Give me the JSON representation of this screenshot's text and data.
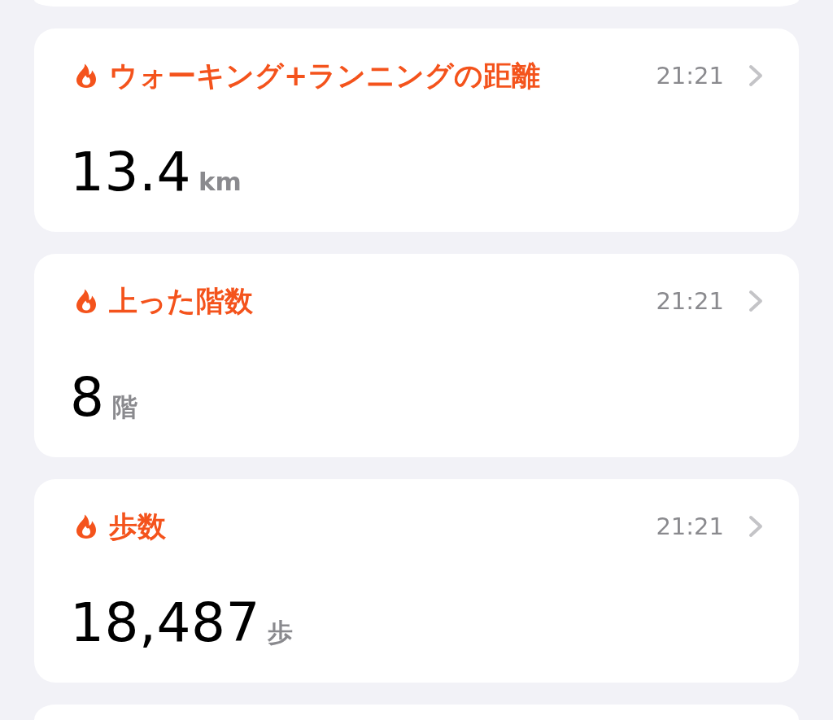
{
  "metrics": [
    {
      "title": "ウォーキング+ランニングの距離",
      "time": "21:21",
      "value": "13.4",
      "unit": "km"
    },
    {
      "title": "上った階数",
      "time": "21:21",
      "value": "8",
      "unit": "階"
    },
    {
      "title": "歩数",
      "time": "21:21",
      "value": "18,487",
      "unit": "歩"
    }
  ]
}
